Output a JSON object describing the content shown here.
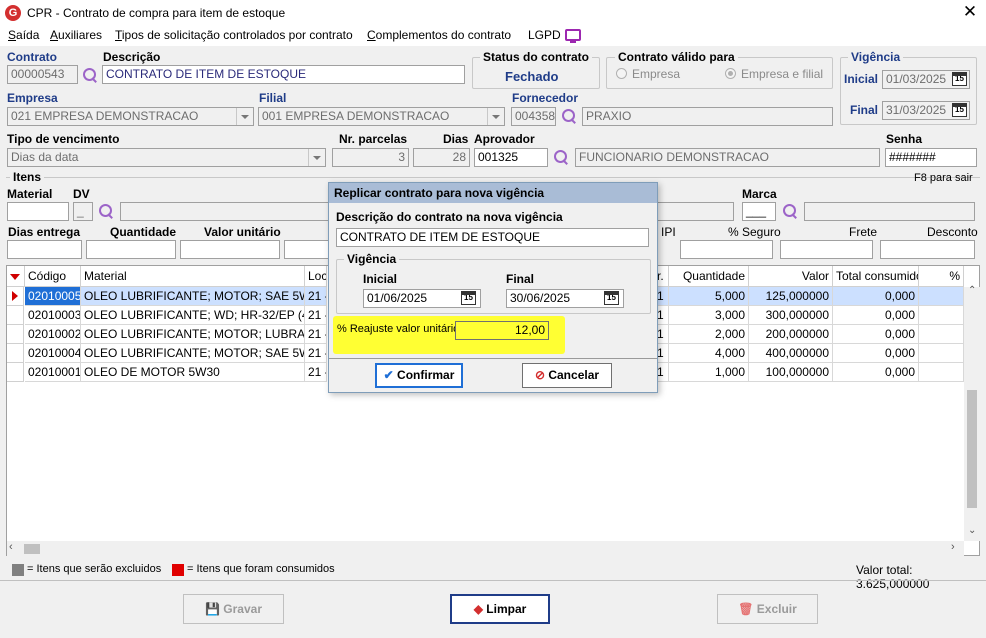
{
  "window": {
    "title": "CPR - Contrato de compra para item de estoque",
    "icon_letter": "G"
  },
  "menu": [
    {
      "label": "Saída",
      "underline": "S",
      "rest": "aída"
    },
    {
      "label": "Auxiliares",
      "underline": "A",
      "rest": "uxiliares"
    },
    {
      "label": "Tipos de solicitação controlados por contrato",
      "underline": "T",
      "rest": "ipos de solicitação controlados por contrato"
    },
    {
      "label": "Complementos do contrato",
      "underline": "C",
      "rest": "omplementos do contrato"
    },
    {
      "label": "LGPD",
      "underline": "",
      "rest": "LGPD"
    }
  ],
  "header": {
    "contrato_label": "Contrato",
    "contrato_value": "00000543",
    "descricao_label": "Descrição",
    "descricao_value": "CONTRATO DE ITEM DE ESTOQUE",
    "status_label": "Status do contrato",
    "status_value": "Fechado",
    "valido_label": "Contrato válido para",
    "valido_opt1": "Empresa",
    "valido_opt2": "Empresa e filial",
    "vigencia_label": "Vigência",
    "inicial_label": "Inicial",
    "inicial_value": "01/03/2025",
    "final_label": "Final",
    "final_value": "31/03/2025",
    "empresa_label": "Empresa",
    "empresa_value": "021 EMPRESA DEMONSTRACAO",
    "filial_label": "Filial",
    "filial_value": "001 EMPRESA DEMONSTRACAO",
    "fornecedor_label": "Fornecedor",
    "fornecedor_code": "004358",
    "fornecedor_name": "PRAXIO",
    "tipo_venc_label": "Tipo de vencimento",
    "tipo_venc_value": "Dias da data",
    "parcelas_label": "Nr. parcelas",
    "parcelas_value": "3",
    "dias_label": "Dias",
    "dias_value": "28",
    "aprovador_label": "Aprovador",
    "aprovador_code": "001325",
    "aprovador_name": "FUNCIONARIO DEMONSTRACAO",
    "senha_label": "Senha",
    "senha_value": "#######"
  },
  "itens": {
    "title": "Itens",
    "f8_hint": "F8 para sair",
    "material_label": "Material",
    "dv_label": "DV",
    "dv_value": "_",
    "marca_label": "Marca",
    "marca_value": "___",
    "dias_entrega_label": "Dias entrega",
    "quantidade_label": "Quantidade",
    "valor_unit_label": "Valor unitário",
    "ipi_label": "IPI",
    "seguro_label": "% Seguro",
    "frete_label": "Frete",
    "desconto_label": "Desconto"
  },
  "grid": {
    "columns": [
      "Código",
      "Material",
      "Loca",
      "r.",
      "Quantidade",
      "Valor",
      "Total consumido",
      "%"
    ],
    "rows": [
      {
        "codigo": "02010005",
        "material": "OLEO LUBRIFICANTE; MOTOR; SAE 5W4...",
        "local": "21 -",
        "r": "1",
        "quantidade": "5,000",
        "valor": "125,000000",
        "total": "0,000"
      },
      {
        "codigo": "02010003",
        "material": "OLEO LUBRIFICANTE; WD; HR-32/EP (43)",
        "local": "21 -",
        "r": "1",
        "quantidade": "3,000",
        "valor": "300,000000",
        "total": "0,000"
      },
      {
        "codigo": "02010002",
        "material": "OLEO LUBRIFICANTE; MOTOR; LUBRAX; ...",
        "local": "21 -",
        "r": "1",
        "quantidade": "2,000",
        "valor": "200,000000",
        "total": "0,000"
      },
      {
        "codigo": "02010004",
        "material": "OLEO LUBRIFICANTE; MOTOR; SAE 5W3...",
        "local": "21 -",
        "r": "1",
        "quantidade": "4,000",
        "valor": "400,000000",
        "total": "0,000"
      },
      {
        "codigo": "02010001",
        "material": "OLEO DE MOTOR 5W30",
        "local": "21 -",
        "r": "1",
        "quantidade": "1,000",
        "valor": "100,000000",
        "total": "0,000"
      }
    ]
  },
  "status": {
    "legend_gray": "= Itens que serão excluidos",
    "legend_red": "= Itens que foram consumidos",
    "total": "Valor total: 3.625,000000",
    "gray_color": "#808080",
    "red_color": "#e00000"
  },
  "buttons": {
    "gravar": "Gravar",
    "limpar": "Limpar",
    "excluir": "Excluir"
  },
  "dialog": {
    "title": "Replicar contrato para nova vigência",
    "descricao_label": "Descrição do contrato na nova vigência",
    "descricao_value": "CONTRATO DE ITEM DE ESTOQUE",
    "vigencia_label": "Vigência",
    "inicial_label": "Inicial",
    "inicial_value": "01/06/2025",
    "final_label": "Final",
    "final_value": "30/06/2025",
    "reajuste_label": "% Reajuste valor unitário",
    "reajuste_value": "12,00",
    "confirmar": "Confirmar",
    "cancelar": "Cancelar",
    "highlight_color": "#ffff33"
  }
}
